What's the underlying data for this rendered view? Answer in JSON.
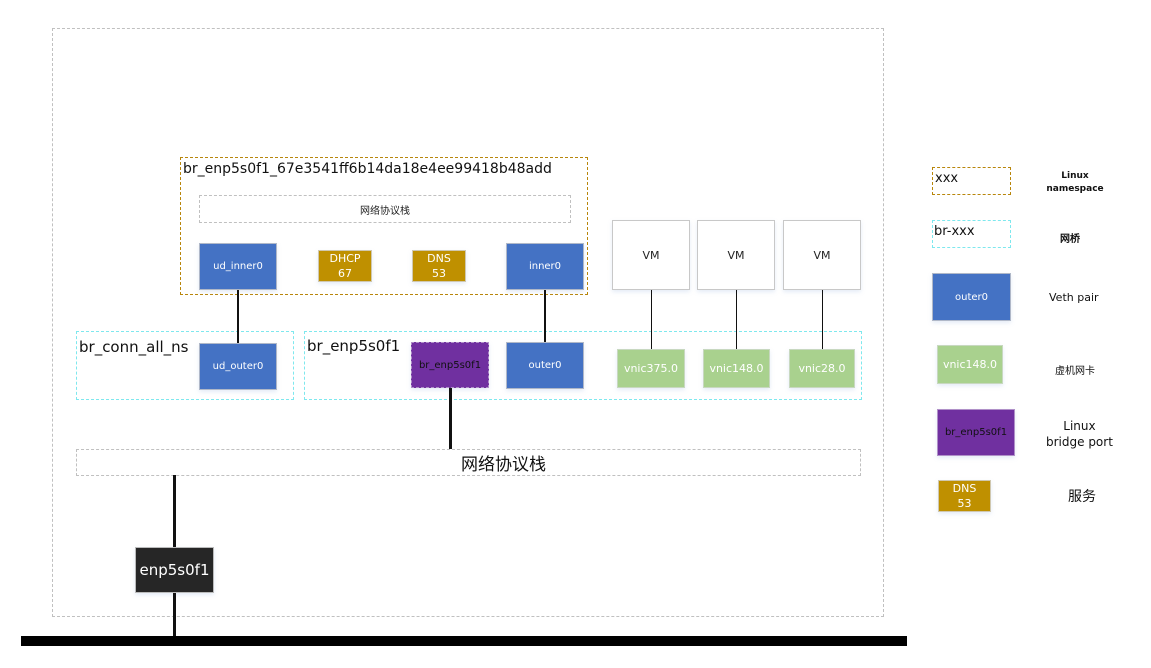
{
  "diagram": {
    "host_namespace": {
      "protocol_stack_label": "网络协议栈",
      "physical_nic": "enp5s0f1"
    },
    "inner_namespace": {
      "name": "br_enp5s0f1_67e3541ff6b14da18e4ee99418b48add",
      "protocol_stack_label": "网络协议栈",
      "interfaces": [
        "ud_inner0",
        "inner0"
      ],
      "services": [
        {
          "name": "DHCP",
          "port": "67"
        },
        {
          "name": "DNS",
          "port": "53"
        }
      ]
    },
    "bridges": [
      {
        "name": "br_conn_all_ns",
        "ports": [
          "ud_outer0"
        ]
      },
      {
        "name": "br_enp5s0f1",
        "ports": [
          "br_enp5s0f1",
          "outer0",
          "vnic375.0",
          "vnic148.0",
          "vnic28.0"
        ]
      }
    ],
    "vms": [
      {
        "label": "VM",
        "vnic": "vnic375.0"
      },
      {
        "label": "VM",
        "vnic": "vnic148.0"
      },
      {
        "label": "VM",
        "vnic": "vnic28.0"
      }
    ],
    "bridge_port_label": "br_enp5s0f1"
  },
  "legend": [
    {
      "sample": "xxx",
      "description": "Linux namespace"
    },
    {
      "sample": "br-xxx",
      "description": "网桥"
    },
    {
      "sample": "outer0",
      "description": "Veth pair"
    },
    {
      "sample": "vnic148.0",
      "description": "虚机网卡"
    },
    {
      "sample": "br_enp5s0f1",
      "description_line1": "Linux",
      "description_line2": "bridge port"
    },
    {
      "sample_line1": "DNS",
      "sample_line2": "53",
      "description": "服务"
    }
  ],
  "colors": {
    "namespace_border": "#b8860b",
    "bridge_border": "#7ee8ee",
    "veth": "#4472c4",
    "vnic": "#a9d18e",
    "bridge_port": "#7030a0",
    "service": "#bf9000",
    "physical_nic": "#262626"
  }
}
